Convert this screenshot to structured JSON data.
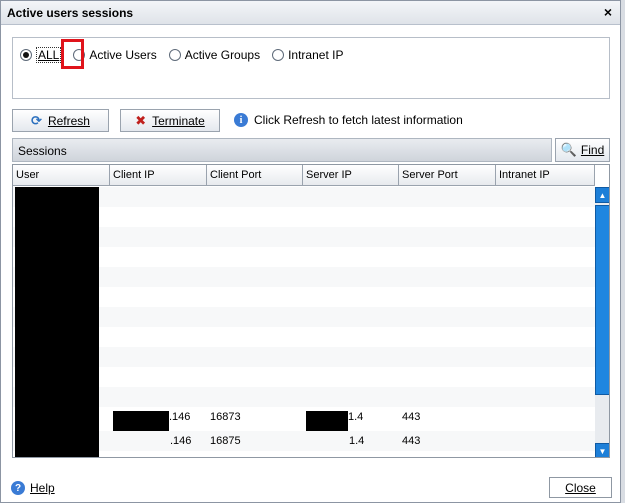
{
  "window": {
    "title": "Active users sessions",
    "close_glyph": "×"
  },
  "filters": {
    "options": [
      {
        "label": "ALL",
        "selected": true
      },
      {
        "label": "Active Users",
        "selected": false
      },
      {
        "label": "Active Groups",
        "selected": false
      },
      {
        "label": "Intranet IP",
        "selected": false
      }
    ]
  },
  "toolbar": {
    "refresh_label": "Refresh",
    "terminate_label": "Terminate",
    "info_text": "Click Refresh to fetch latest information"
  },
  "sessions": {
    "title": "Sessions",
    "find_label": "Find",
    "columns": [
      "User",
      "Client IP",
      "Client Port",
      "Server IP",
      "Server Port",
      "Intranet IP"
    ],
    "rows": [
      {
        "client_ip": ".146",
        "client_port": "16873",
        "server_ip": "1.4",
        "server_port": "443"
      },
      {
        "client_ip": ".146",
        "client_port": "16875",
        "server_ip": "1.4",
        "server_port": "443"
      }
    ]
  },
  "footer": {
    "help_label": "Help",
    "close_label": "Close"
  },
  "colors": {
    "highlight": "#e0141b",
    "scroll_accent": "#1f86e0"
  }
}
